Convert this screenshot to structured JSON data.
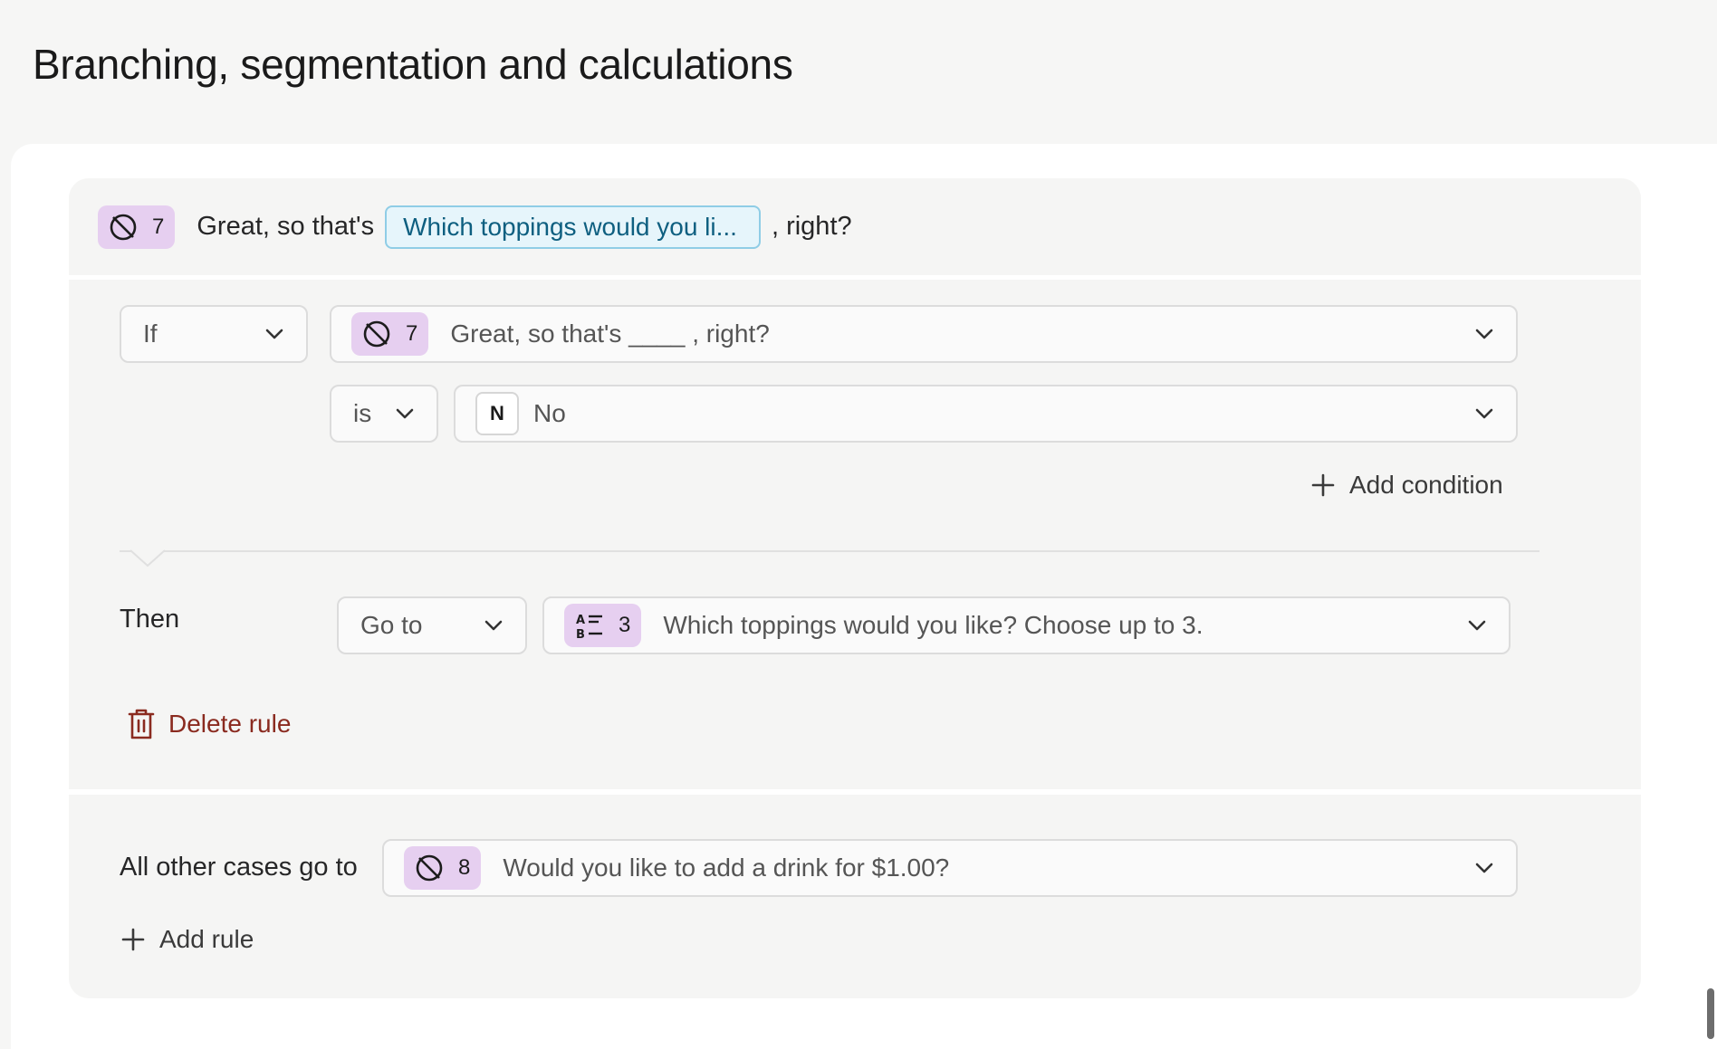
{
  "page": {
    "title": "Branching, segmentation and calculations"
  },
  "question": {
    "number": "7",
    "icon": "no-symbol-icon",
    "text_before": "Great, so that's",
    "recall_chip": "Which toppings would you li...",
    "text_after": ", right?"
  },
  "rule": {
    "if_select": "If",
    "condition_question": {
      "number": "7",
      "icon": "no-symbol-icon",
      "text": "Great, so that's ____ , right?"
    },
    "operator": "is",
    "value": {
      "key": "N",
      "label": "No"
    },
    "add_condition": "Add condition",
    "then_label": "Then",
    "action": "Go to",
    "destination": {
      "number": "3",
      "icon": "multiple-choice-icon",
      "text": "Which toppings would you like? Choose up to 3."
    },
    "delete_rule": "Delete rule"
  },
  "fallback": {
    "label": "All other cases go to",
    "destination": {
      "number": "8",
      "icon": "no-symbol-icon",
      "text": "Would you like to add a drink for $1.00?"
    }
  },
  "add_rule": "Add rule",
  "colors": {
    "badge_bg": "#e6cff0",
    "recall_bg": "#e6f5fb",
    "recall_border": "#8fcde6",
    "recall_text": "#0e5f80",
    "delete_text": "#8a2a1f"
  }
}
